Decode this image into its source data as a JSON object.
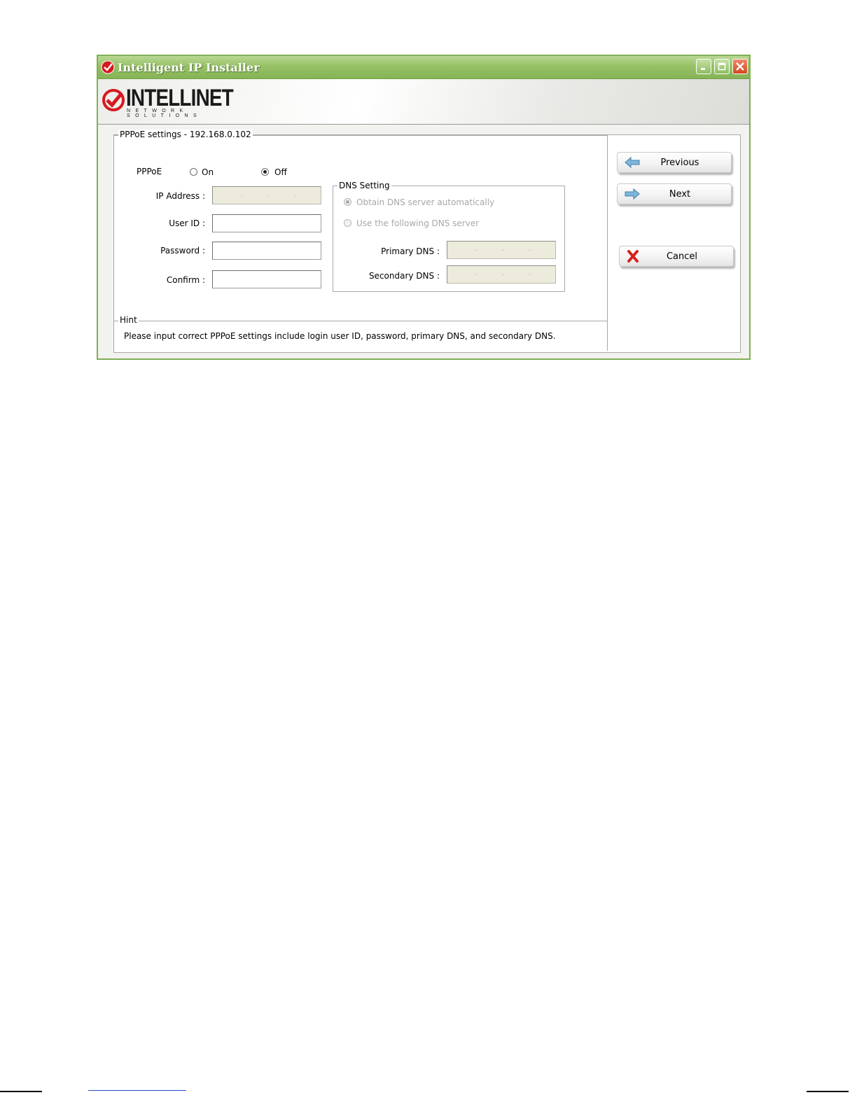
{
  "window": {
    "title": "Intelligent IP Installer",
    "accent_color": "#8cba5b",
    "title_icon": "intellinet-check-icon",
    "controls": {
      "minimize": "minimize-icon",
      "maximize": "maximize-icon",
      "close": "close-icon"
    }
  },
  "logo": {
    "name": "INTELLINET",
    "tagline": "NETWORK SOLUTIONS",
    "brand_color": "#d71920"
  },
  "settings": {
    "group_title": "PPPoE settings - 192.168.0.102",
    "pppoe": {
      "label": "PPPoE",
      "on_label": "On",
      "off_label": "Off",
      "selected": "Off"
    },
    "fields": {
      "ip_address_label": "IP Address :",
      "user_id_label": "User ID :",
      "user_id_value": "",
      "password_label": "Password :",
      "password_value": "",
      "confirm_label": "Confirm :",
      "confirm_value": ""
    },
    "dns": {
      "group_title": "DNS Setting",
      "auto_label": "Obtain DNS server automatically",
      "manual_label": "Use the following DNS server",
      "selected": "auto",
      "primary_label": "Primary DNS :",
      "secondary_label": "Secondary DNS :"
    }
  },
  "hint": {
    "title": "Hint",
    "text": "Please input correct PPPoE settings include login user ID, password, primary DNS, and secondary DNS."
  },
  "buttons": {
    "previous": {
      "label": "Previous",
      "icon": "arrow-left-icon"
    },
    "next": {
      "label": "Next",
      "icon": "arrow-right-icon"
    },
    "cancel": {
      "label": "Cancel",
      "icon": "red-x-icon"
    }
  }
}
